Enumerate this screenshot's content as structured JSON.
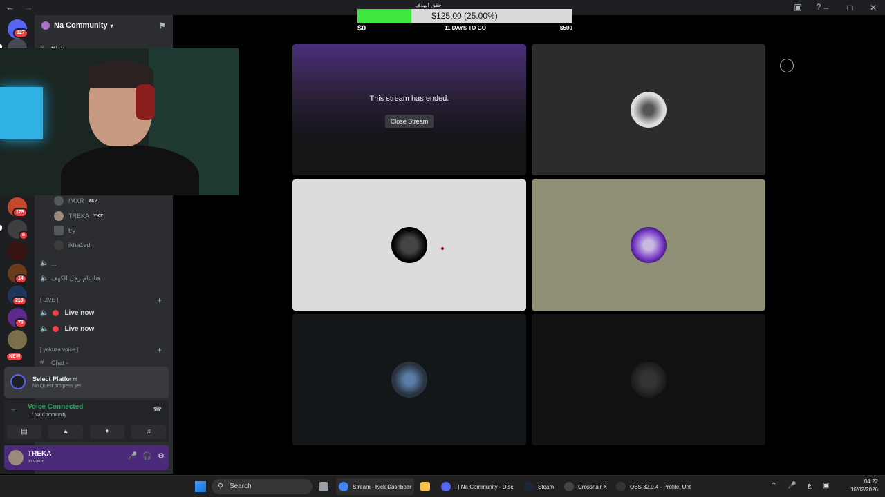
{
  "colors": {
    "accent": "#5865f2",
    "online": "#23a55a",
    "live_red": "#f23f43",
    "goal_fill": "#3ee63e",
    "user_panel": "#4b2a7a"
  },
  "titlebar": {
    "back_icon": "arrow-left",
    "forward_icon": "arrow-right"
  },
  "rail": {
    "badges": [
      "127",
      "178",
      "5",
      "14",
      "218",
      "70",
      "NEW"
    ]
  },
  "server": {
    "name": "Na Community"
  },
  "channels": {
    "top_channel": "Kick",
    "members": [
      {
        "name": "!MXR",
        "tag": "YKZ"
      },
      {
        "name": "TREKA",
        "tag": "YKZ"
      },
      {
        "name": "try",
        "tag": ""
      },
      {
        "name": "ikha1ed",
        "tag": ""
      }
    ],
    "voice_1": "...",
    "voice_2": "هنا ينام رجل الكهف",
    "live_category": "[ LIVE ]",
    "live_channels": [
      "Live now",
      "Live now"
    ],
    "yakuza_category": "[ yakuza voice ]",
    "chat_channel": "Chat -"
  },
  "quest": {
    "title": "Select Platform",
    "subtitle": "No Quest progress yet"
  },
  "voice": {
    "status": "Voice Connected",
    "location": ".. / Na Community"
  },
  "user": {
    "name": "TREKA",
    "status": "In voice"
  },
  "goal": {
    "above_text": "حقق الهدف",
    "label": "$125.00 (25.00%)",
    "progress": 0.25,
    "min": "$0",
    "days": "11 DAYS TO GO",
    "max": "$500"
  },
  "stream": {
    "ended_text": "This stream has ended.",
    "close_label": "Close Stream"
  },
  "taskbar": {
    "search": "Search",
    "apps": [
      {
        "label": "Stream - Kick Dashboar",
        "color": "#4285f4"
      },
      {
        "label": "",
        "color": "#f2c14e"
      },
      {
        "label": ". | Na Community - Disc",
        "color": "#5865f2"
      },
      {
        "label": "Steam",
        "color": "#1b2838"
      },
      {
        "label": "Crosshair X",
        "color": "#444"
      },
      {
        "label": "OBS 32.0.4 - Profile: Unt",
        "color": "#333"
      }
    ],
    "lang": "ع",
    "time": "04:22",
    "date": "16/02/2026"
  }
}
